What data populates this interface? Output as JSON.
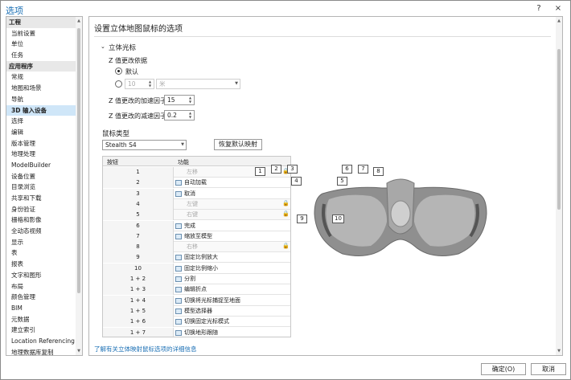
{
  "window": {
    "title": "选项",
    "help_glyph": "?",
    "close_glyph": "×"
  },
  "nav": {
    "items": [
      {
        "label": "工程",
        "group": true
      },
      {
        "label": "当前设置"
      },
      {
        "label": "单位"
      },
      {
        "label": "任务"
      },
      {
        "label": "应用程序",
        "group": true
      },
      {
        "label": "常规"
      },
      {
        "label": "地图和场景"
      },
      {
        "label": "导航"
      },
      {
        "label": "3D 输入设备",
        "selected": true
      },
      {
        "label": "选择"
      },
      {
        "label": "编辑"
      },
      {
        "label": "版本管理"
      },
      {
        "label": "地理处理"
      },
      {
        "label": "ModelBuilder"
      },
      {
        "label": "设备位置"
      },
      {
        "label": "目录浏览"
      },
      {
        "label": "共享和下载"
      },
      {
        "label": "身份验证"
      },
      {
        "label": "栅格和影像"
      },
      {
        "label": "全动态视频"
      },
      {
        "label": "显示"
      },
      {
        "label": "表"
      },
      {
        "label": "报表"
      },
      {
        "label": "文字和图形"
      },
      {
        "label": "布局"
      },
      {
        "label": "颜色管理"
      },
      {
        "label": "BIM"
      },
      {
        "label": "元数据"
      },
      {
        "label": "建立索引"
      },
      {
        "label": "Location Referencing"
      },
      {
        "label": "地理数据库复制"
      }
    ]
  },
  "main": {
    "heading": "设置立体地图鼠标的选项",
    "section_title": "立体光标",
    "z_label": "Z 值更改依据",
    "radio_default": "默认",
    "radio_custom_value": "10",
    "unit_placeholder": "米",
    "accel_label": "Z 值更改的加速因子",
    "accel_value": "15",
    "decel_label": "Z 值更改的减速因子",
    "decel_value": "0.2",
    "mouse_type_title": "鼠标类型",
    "mouse_type_value": "Stealth S4",
    "restore_button": "恢复默认映射",
    "table": {
      "col_button": "按钮",
      "col_function": "功能",
      "rows": [
        {
          "k": "1",
          "f": "左移",
          "disabled": true
        },
        {
          "k": "2",
          "f": "自动加载"
        },
        {
          "k": "3",
          "f": "取消"
        },
        {
          "k": "4",
          "f": "左键",
          "disabled": true
        },
        {
          "k": "5",
          "f": "右键",
          "disabled": true
        },
        {
          "k": "6",
          "f": "完成"
        },
        {
          "k": "7",
          "f": "缩放至模型"
        },
        {
          "k": "8",
          "f": "右移",
          "disabled": true
        },
        {
          "k": "9",
          "f": "固定比例放大"
        },
        {
          "k": "10",
          "f": "固定比例缩小"
        },
        {
          "k": "1 + 2",
          "f": "分割"
        },
        {
          "k": "1 + 3",
          "f": "编辑折点"
        },
        {
          "k": "1 + 4",
          "f": "切换将光标捕捉至地面"
        },
        {
          "k": "1 + 5",
          "f": "模型选择器"
        },
        {
          "k": "1 + 6",
          "f": "切换固定光标模式"
        },
        {
          "k": "1 + 7",
          "f": "切换地形跟随"
        }
      ]
    },
    "mouse_buttons": [
      "1",
      "2",
      "3",
      "4",
      "5",
      "6",
      "7",
      "8",
      "9",
      "10"
    ],
    "details_link": "了解有关立体映射鼠标选项的详细信息"
  },
  "footer": {
    "ok": "确定(O)",
    "cancel": "取消"
  },
  "colors": {
    "accent": "#1a6fb4",
    "selected_row": "#cfe6f8"
  }
}
